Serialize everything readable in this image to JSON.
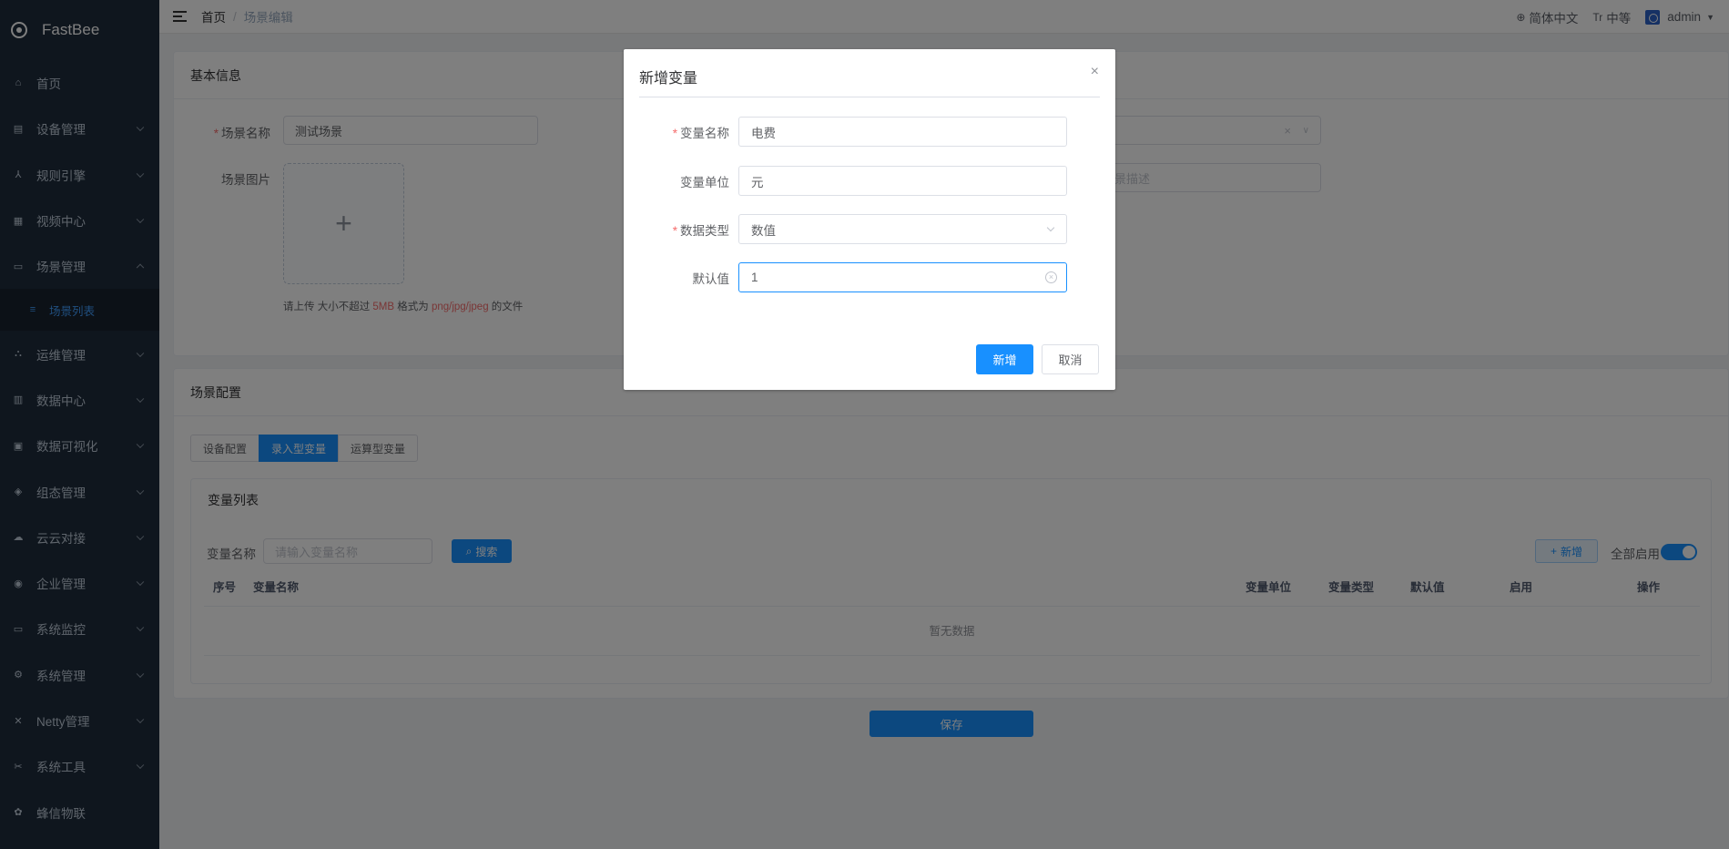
{
  "app": {
    "name": "FastBee"
  },
  "sidebar": {
    "items": [
      {
        "label": "首页",
        "icon": "home-icon"
      },
      {
        "label": "设备管理",
        "icon": "device-icon"
      },
      {
        "label": "规则引擎",
        "icon": "rule-icon"
      },
      {
        "label": "视频中心",
        "icon": "video-icon"
      },
      {
        "label": "场景管理",
        "icon": "scene-icon"
      },
      {
        "label": "场景列表",
        "icon": "list-icon"
      },
      {
        "label": "运维管理",
        "icon": "ops-icon"
      },
      {
        "label": "数据中心",
        "icon": "data-icon"
      },
      {
        "label": "数据可视化",
        "icon": "visual-icon"
      },
      {
        "label": "组态管理",
        "icon": "layers-icon"
      },
      {
        "label": "云云对接",
        "icon": "cloud-icon"
      },
      {
        "label": "企业管理",
        "icon": "enterprise-icon"
      },
      {
        "label": "系统监控",
        "icon": "monitor-icon"
      },
      {
        "label": "系统管理",
        "icon": "settings-icon"
      },
      {
        "label": "Netty管理",
        "icon": "netty-icon"
      },
      {
        "label": "系统工具",
        "icon": "tools-icon"
      },
      {
        "label": "蜂信物联",
        "icon": "bee-icon"
      }
    ]
  },
  "navbar": {
    "breadcrumb": {
      "home": "首页",
      "separator": "/",
      "current": "场景编辑"
    },
    "language": "简体中文",
    "size": "中等",
    "size_icon": "Tr",
    "user": "admin"
  },
  "basic_info": {
    "title": "基本信息",
    "name_label": "场景名称",
    "name_value": "测试场景",
    "image_label": "场景图片",
    "upload_plus": "+",
    "tip_prefix": "请上传 大小不超过 ",
    "tip_size": "5MB",
    "tip_mid": " 格式为 ",
    "tip_formats": "png/jpg/jpeg",
    "tip_suffix": " 的文件",
    "desc_placeholder": "景描述"
  },
  "scene_config": {
    "title": "场景配置",
    "tabs": [
      "设备配置",
      "录入型变量",
      "运算型变量"
    ],
    "variable_list_title": "变量列表",
    "search_label": "变量名称",
    "search_placeholder": "请输入变量名称",
    "search_button": "搜索",
    "add_button": "新增",
    "enable_all_label": "全部启用",
    "columns": [
      "序号",
      "变量名称",
      "变量单位",
      "变量类型",
      "默认值",
      "启用",
      "操作"
    ],
    "empty_text": "暂无数据",
    "save_button": "保存"
  },
  "dialog": {
    "title": "新增变量",
    "close": "×",
    "fields": {
      "name": {
        "label": "变量名称",
        "value": "电费",
        "required": true
      },
      "unit": {
        "label": "变量单位",
        "value": "元",
        "required": false
      },
      "type": {
        "label": "数据类型",
        "value": "数值",
        "required": true
      },
      "default": {
        "label": "默认值",
        "value": "1",
        "required": false
      }
    },
    "confirm_button": "新增",
    "cancel_button": "取消"
  },
  "colors": {
    "primary": "#1890ff",
    "sidebar_bg": "#1f2d3d",
    "required": "#f56c6c"
  }
}
